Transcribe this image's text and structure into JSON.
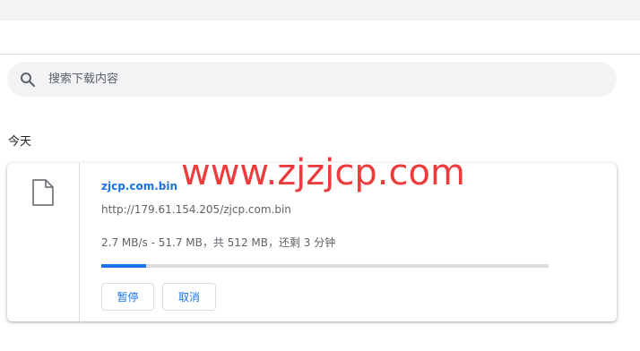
{
  "search": {
    "placeholder": "搜索下载内容",
    "icon": "search-icon"
  },
  "section": {
    "heading": "今天"
  },
  "download": {
    "file_name": "zjcp.com.bin",
    "url": "http://179.61.154.205/zjcp.com.bin",
    "status": "2.7 MB/s - 51.7 MB，共 512 MB，还剩 3 分钟",
    "progress_fraction": 0.101,
    "icon": "file-icon",
    "pause_label": "暂停",
    "cancel_label": "取消"
  },
  "watermark": "www.zjzjcp.com",
  "colors": {
    "accent": "#1a73e8",
    "watermark": "#ee3b3b",
    "search_bg": "#f1f3f4"
  }
}
